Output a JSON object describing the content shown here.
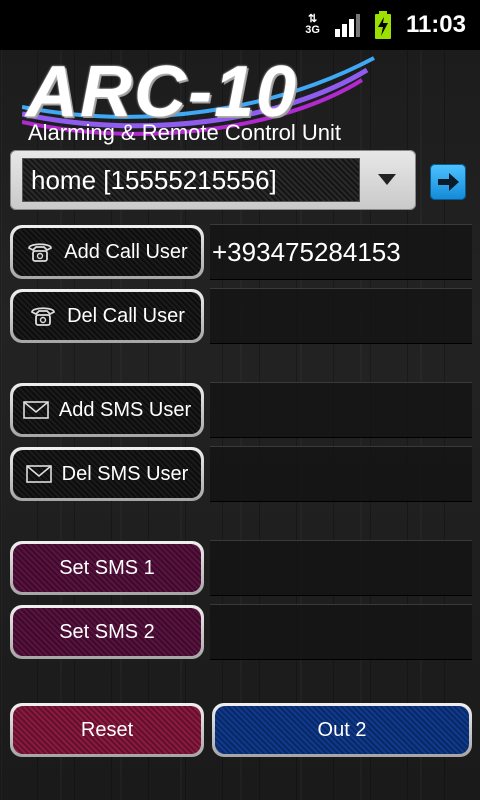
{
  "status_bar": {
    "network_type": "3G",
    "time": "11:03"
  },
  "header": {
    "title": "ARC-10",
    "subtitle": "Alarming & Remote Control Unit"
  },
  "selector": {
    "selected": "home [15555215556]"
  },
  "actions": {
    "add_call_user": {
      "label": "Add Call User",
      "value": "+393475284153"
    },
    "del_call_user": {
      "label": "Del Call User",
      "value": ""
    },
    "add_sms_user": {
      "label": "Add SMS User",
      "value": ""
    },
    "del_sms_user": {
      "label": "Del SMS User",
      "value": ""
    },
    "set_sms_1": {
      "label": "Set SMS 1",
      "value": ""
    },
    "set_sms_2": {
      "label": "Set SMS 2",
      "value": ""
    }
  },
  "footer": {
    "reset_label": "Reset",
    "out2_label": "Out 2"
  },
  "colors": {
    "accent_blue": "#1a9be6",
    "swoosh_blue": "#3fa9f5",
    "swoosh_magenta": "#b12ad0",
    "magenta_button": "#4a0e34",
    "reset_button": "#7a1636",
    "out_button": "#0e3179"
  },
  "icons": {
    "call": "telephone-icon",
    "sms": "envelope-icon",
    "go": "arrow-right-icon"
  }
}
